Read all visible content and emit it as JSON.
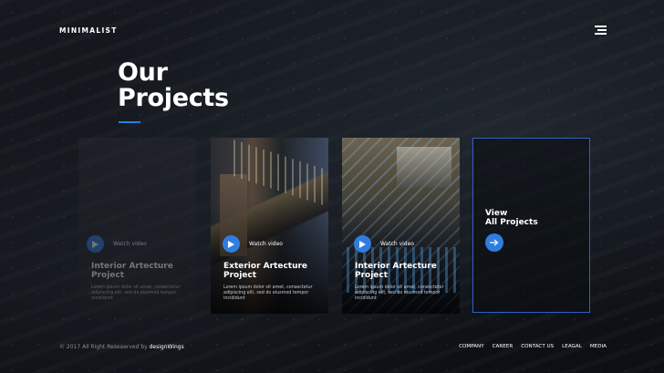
{
  "brand": "MINIMALIST",
  "heading": {
    "line1": "Our",
    "line2": "Projects"
  },
  "cards": [
    {
      "title_line1": "Interior Artecture",
      "title_line2": "Project",
      "watch_label": "Watch video",
      "description": "Lorem ipsum dolor sit amet, consectetur adipiscing elit, sed do eiusmod tempor incididunt"
    },
    {
      "title_line1": "Exterior Artecture",
      "title_line2": "Project",
      "watch_label": "Watch video",
      "description": "Lorem ipsum dolor sit amet, consectetur adipiscing elit, sed do eiusmod tempor incididunt"
    },
    {
      "title_line1": "Interior Artecture",
      "title_line2": "Project",
      "watch_label": "Watch video",
      "description": "Lorem ipsum dolor sit amet, consectetur adipiscing elit, sed do eiusmod tempor incididunt"
    }
  ],
  "view_all": {
    "line1": "View",
    "line2": "All Projects"
  },
  "footer": {
    "copyright": "© 2017 All Right Reseaerved by",
    "brand": "designWings",
    "nav": [
      "COMPANY",
      "CAREER",
      "CONTACT US",
      "LEAGAL",
      "MEDIA"
    ]
  },
  "colors": {
    "accent": "#2f7de1",
    "border_accent": "#2f5fc4",
    "background": "#0e1116"
  },
  "icons": {
    "menu": "hamburger-icon",
    "play": "play-icon",
    "arrow": "arrow-right-icon"
  }
}
